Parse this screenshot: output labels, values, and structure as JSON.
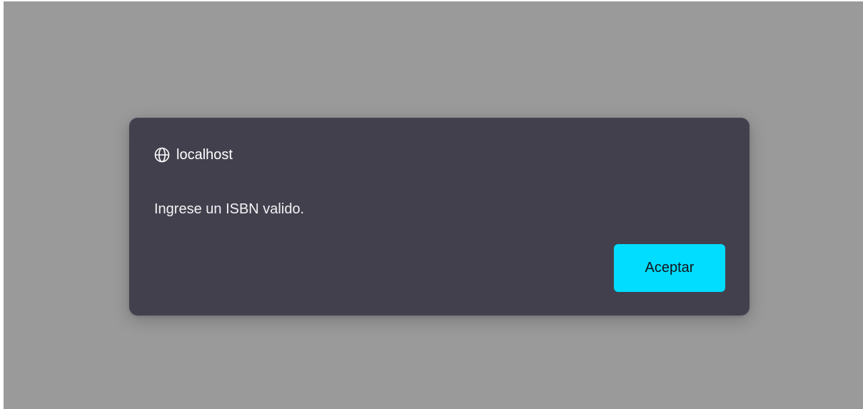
{
  "dialog": {
    "origin": "localhost",
    "origin_icon": "globe-icon",
    "message": "Ingrese un ISBN valido.",
    "accept_label": "Aceptar"
  },
  "colors": {
    "backdrop": "#9a9a9b",
    "dialog_bg": "#43404e",
    "accent": "#00ddff",
    "button_text": "#15141a",
    "text": "#ffffff"
  }
}
